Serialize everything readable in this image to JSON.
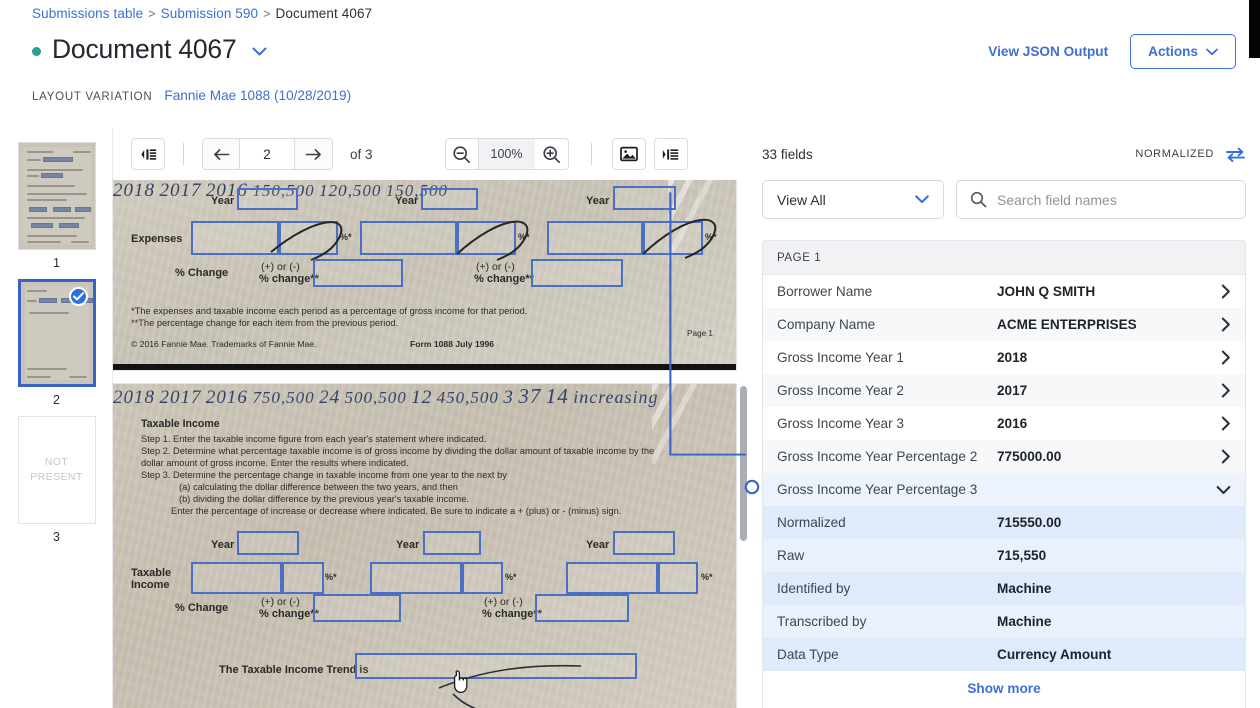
{
  "breadcrumb": {
    "items": [
      {
        "label": "Submissions table",
        "link": true
      },
      {
        "label": "Submission 590",
        "link": true
      },
      {
        "label": "Document 4067",
        "link": false
      }
    ],
    "separator": ">"
  },
  "header": {
    "title": "Document 4067",
    "status_color": "#2e9e8f",
    "title_caret": "⌄",
    "layout_variation_label": "LAYOUT VARIATION",
    "layout_variation_value": "Fannie Mae 1088 (10/28/2019)",
    "view_json_label": "View JSON Output",
    "actions_label": "Actions",
    "actions_caret": "⌄",
    "accent_color": "#3d6fd4"
  },
  "thumbnails": [
    {
      "number": "1",
      "selected": false,
      "not_present": false,
      "placeholder": ""
    },
    {
      "number": "2",
      "selected": true,
      "not_present": false,
      "placeholder": ""
    },
    {
      "number": "3",
      "selected": false,
      "not_present": true,
      "placeholder": "NOT\nPRESENT"
    }
  ],
  "toolbar": {
    "collapse_left_icon": "panel-collapse-left-icon",
    "prev_label": "←",
    "next_label": "→",
    "page_value": "2",
    "page_total": "of 3",
    "zoom_out_icon": "zoom-out-icon",
    "zoom_value": "100%",
    "zoom_in_icon": "zoom-in-icon",
    "image_icon": "image-icon",
    "collapse_right_icon": "panel-collapse-right-icon"
  },
  "document": {
    "section_top": {
      "years": [
        "2018",
        "2017",
        "2016"
      ],
      "year_label": "Year",
      "row_label": "Expenses",
      "amounts": [
        "150,500",
        "120,500",
        "150,500"
      ],
      "pct_label": "%*",
      "change_label": "% Change",
      "change_sub": "(+) or (-)\n% change**",
      "footnote_1": "*The expenses and taxable income each period as a percentage of gross income for that period.",
      "footnote_2": "**The percentage change for each item from the previous period.",
      "copyright": "© 2016 Fannie Mae. Trademarks of Fannie Mae.",
      "form_id": "Form 1088  July 1996",
      "page_mark": "Page 1"
    },
    "section_bottom": {
      "heading": "Taxable Income",
      "steps": [
        "Step 1. Enter the taxable income figure from each year's statement where indicated.",
        "Step 2. Determine what percentage taxable income is of gross income by dividing the dollar amount of taxable income by the",
        "dollar amount of gross income. Enter the results where indicated.",
        "Step 3. Determine the percentage change in taxable income from one year to the next by",
        "(a) calculating the dollar difference between the two years, and then",
        "(b) dividing the dollar difference by the previous year's taxable income.",
        "Enter the percentage of increase or decrease where indicated. Be sure to indicate a + (plus) or - (minus) sign."
      ],
      "year_label": "Year",
      "years": [
        "2018",
        "2017",
        "2016"
      ],
      "row_label_1": "Taxable",
      "row_label_2": "Income",
      "amounts": [
        "750,500",
        "500,500",
        "450,500"
      ],
      "percents": [
        "24",
        "12",
        "3"
      ],
      "pct_label": "%*",
      "change_label": "% Change",
      "change_sub": "(+) or (-)\n% change**",
      "change_values": [
        "37",
        "14"
      ],
      "trend_label": "The Taxable Income Trend is",
      "trend_value": "increasing"
    }
  },
  "panel": {
    "field_count": "33 fields",
    "normalized_label": "NORMALIZED",
    "toggle_icon": "swap-arrows-icon",
    "view_select_value": "View All",
    "search_placeholder": "Search field names",
    "search_value": "",
    "group_header": "PAGE 1",
    "fields": [
      {
        "key": "Borrower Name",
        "value": "JOHN Q SMITH",
        "state": "collapsed"
      },
      {
        "key": "Company Name",
        "value": "ACME ENTERPRISES",
        "state": "collapsed"
      },
      {
        "key": "Gross Income Year 1",
        "value": "2018",
        "state": "collapsed"
      },
      {
        "key": "Gross Income Year 2",
        "value": "2017",
        "state": "collapsed"
      },
      {
        "key": "Gross Income Year 3",
        "value": "2016",
        "state": "collapsed"
      },
      {
        "key": "Gross Income Year Percentage 2",
        "value": "775000.00",
        "state": "collapsed"
      },
      {
        "key": "Gross Income Year Percentage 3",
        "value": "",
        "state": "expanded"
      }
    ],
    "detail_rows": [
      {
        "key": "Normalized",
        "value": "715550.00"
      },
      {
        "key": "Raw",
        "value": "715,550"
      },
      {
        "key": "Identified by",
        "value": "Machine"
      },
      {
        "key": "Transcribed by",
        "value": "Machine"
      },
      {
        "key": "Data Type",
        "value": "Currency Amount"
      }
    ],
    "show_more_label": "Show more",
    "chevron_right": "›",
    "chevron_down": "⌄"
  }
}
